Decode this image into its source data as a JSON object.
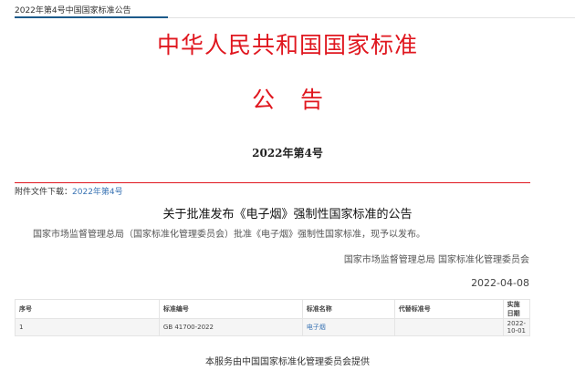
{
  "breadcrumb": "2022年第4号中国国家标准公告",
  "title": "中华人民共和国国家标准",
  "notice": "公告",
  "number": "2022年第4号",
  "attachment": {
    "label": "附件文件下载：",
    "link": "2022年第4号"
  },
  "heading": "关于批准发布《电子烟》强制性国家标准的公告",
  "body": "国家市场监督管理总局（国家标准化管理委员会）批准《电子烟》强制性国家标准，现予以发布。",
  "signature": "国家市场监督管理总局 国家标准化管理委员会",
  "date": "2022-04-08",
  "table": {
    "headers": [
      "序号",
      "标准编号",
      "标准名称",
      "代替标准号",
      "实施日期"
    ],
    "rows": [
      [
        "1",
        "GB 41700-2022",
        "电子烟",
        "",
        "2022-10-01"
      ]
    ]
  },
  "footer": "本服务由中国国家标准化管理委员会提供"
}
